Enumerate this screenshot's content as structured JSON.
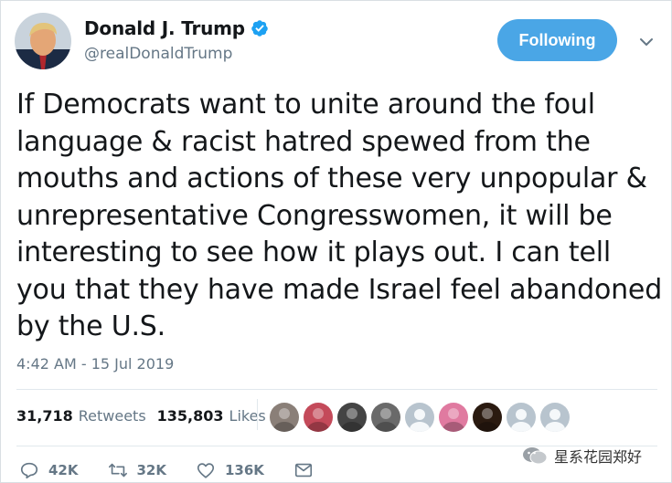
{
  "user": {
    "display_name": "Donald J. Trump",
    "handle": "@realDonaldTrump",
    "verified": true
  },
  "follow_button": {
    "label": "Following",
    "color": "#4aa6e6"
  },
  "tweet": {
    "text": "If Democrats want to unite around the foul language & racist hatred spewed from the mouths and actions of these very unpopular & unrepresentative Congresswomen, it will be interesting to see how it plays out. I can tell you that they have made Israel feel abandoned by the U.S.",
    "timestamp": "4:42 AM - 15 Jul 2019"
  },
  "stats": {
    "retweets_count": "31,718",
    "retweets_label": "Retweets",
    "likes_count": "135,803",
    "likes_label": "Likes"
  },
  "likers": [
    {
      "kind": "photo",
      "color": "#8a7f78"
    },
    {
      "kind": "photo",
      "color": "#c44a5a"
    },
    {
      "kind": "photo",
      "color": "#444444"
    },
    {
      "kind": "photo",
      "color": "#6a6a6a"
    },
    {
      "kind": "default",
      "color": "#b8c4ce"
    },
    {
      "kind": "photo",
      "color": "#e07aa0"
    },
    {
      "kind": "photo",
      "color": "#2a1a10"
    },
    {
      "kind": "default",
      "color": "#b8c4ce"
    },
    {
      "kind": "default",
      "color": "#b8c4ce"
    }
  ],
  "actions": {
    "replies": "42K",
    "retweets": "32K",
    "likes": "136K"
  },
  "watermark": {
    "text": "星系花园郑好"
  },
  "icons": {
    "verified": "verified-badge-icon",
    "caret": "chevron-down-icon",
    "reply": "reply-icon",
    "retweet": "retweet-icon",
    "like": "heart-icon",
    "dm": "envelope-icon"
  }
}
